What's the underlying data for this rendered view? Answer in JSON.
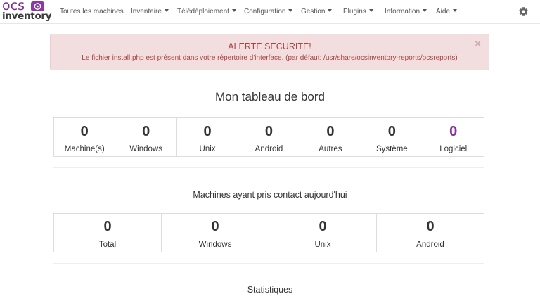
{
  "brand": {
    "line1": "OCS",
    "line2": "inventory",
    "accent": "#7a2c8f"
  },
  "nav": {
    "items": [
      {
        "label": "Toutes les machines",
        "dropdown": false
      },
      {
        "label": "Inventaire",
        "dropdown": true
      },
      {
        "label": "Télédéploiement",
        "dropdown": true
      },
      {
        "label": "Configuration",
        "dropdown": true
      },
      {
        "label": "Gestion",
        "dropdown": true
      },
      {
        "label": "Plugins",
        "dropdown": true
      },
      {
        "label": "Information",
        "dropdown": true
      },
      {
        "label": "Aide",
        "dropdown": true
      }
    ],
    "settings_icon": "gear-icon"
  },
  "alert": {
    "title": "ALERTE SECURITE!",
    "message": "Le fichier install.php est présent dans votre répertoire d'interface. (par défaut: /usr/share/ocsinventory-reports/ocsreports)",
    "close": "×",
    "bg": "#f2dede",
    "text_color": "#a94442"
  },
  "dashboard": {
    "title": "Mon tableau de bord",
    "stats": [
      {
        "value": "0",
        "label": "Machine(s)"
      },
      {
        "value": "0",
        "label": "Windows"
      },
      {
        "value": "0",
        "label": "Unix"
      },
      {
        "value": "0",
        "label": "Android"
      },
      {
        "value": "0",
        "label": "Autres"
      },
      {
        "value": "0",
        "label": "Système"
      },
      {
        "value": "0",
        "label": "Logiciel",
        "color": "#8a2b9e"
      }
    ]
  },
  "contact": {
    "title": "Machines ayant pris contact aujourd'hui",
    "stats": [
      {
        "value": "0",
        "label": "Total"
      },
      {
        "value": "0",
        "label": "Windows"
      },
      {
        "value": "0",
        "label": "Unix"
      },
      {
        "value": "0",
        "label": "Android"
      }
    ]
  },
  "statistics": {
    "title": "Statistiques"
  }
}
